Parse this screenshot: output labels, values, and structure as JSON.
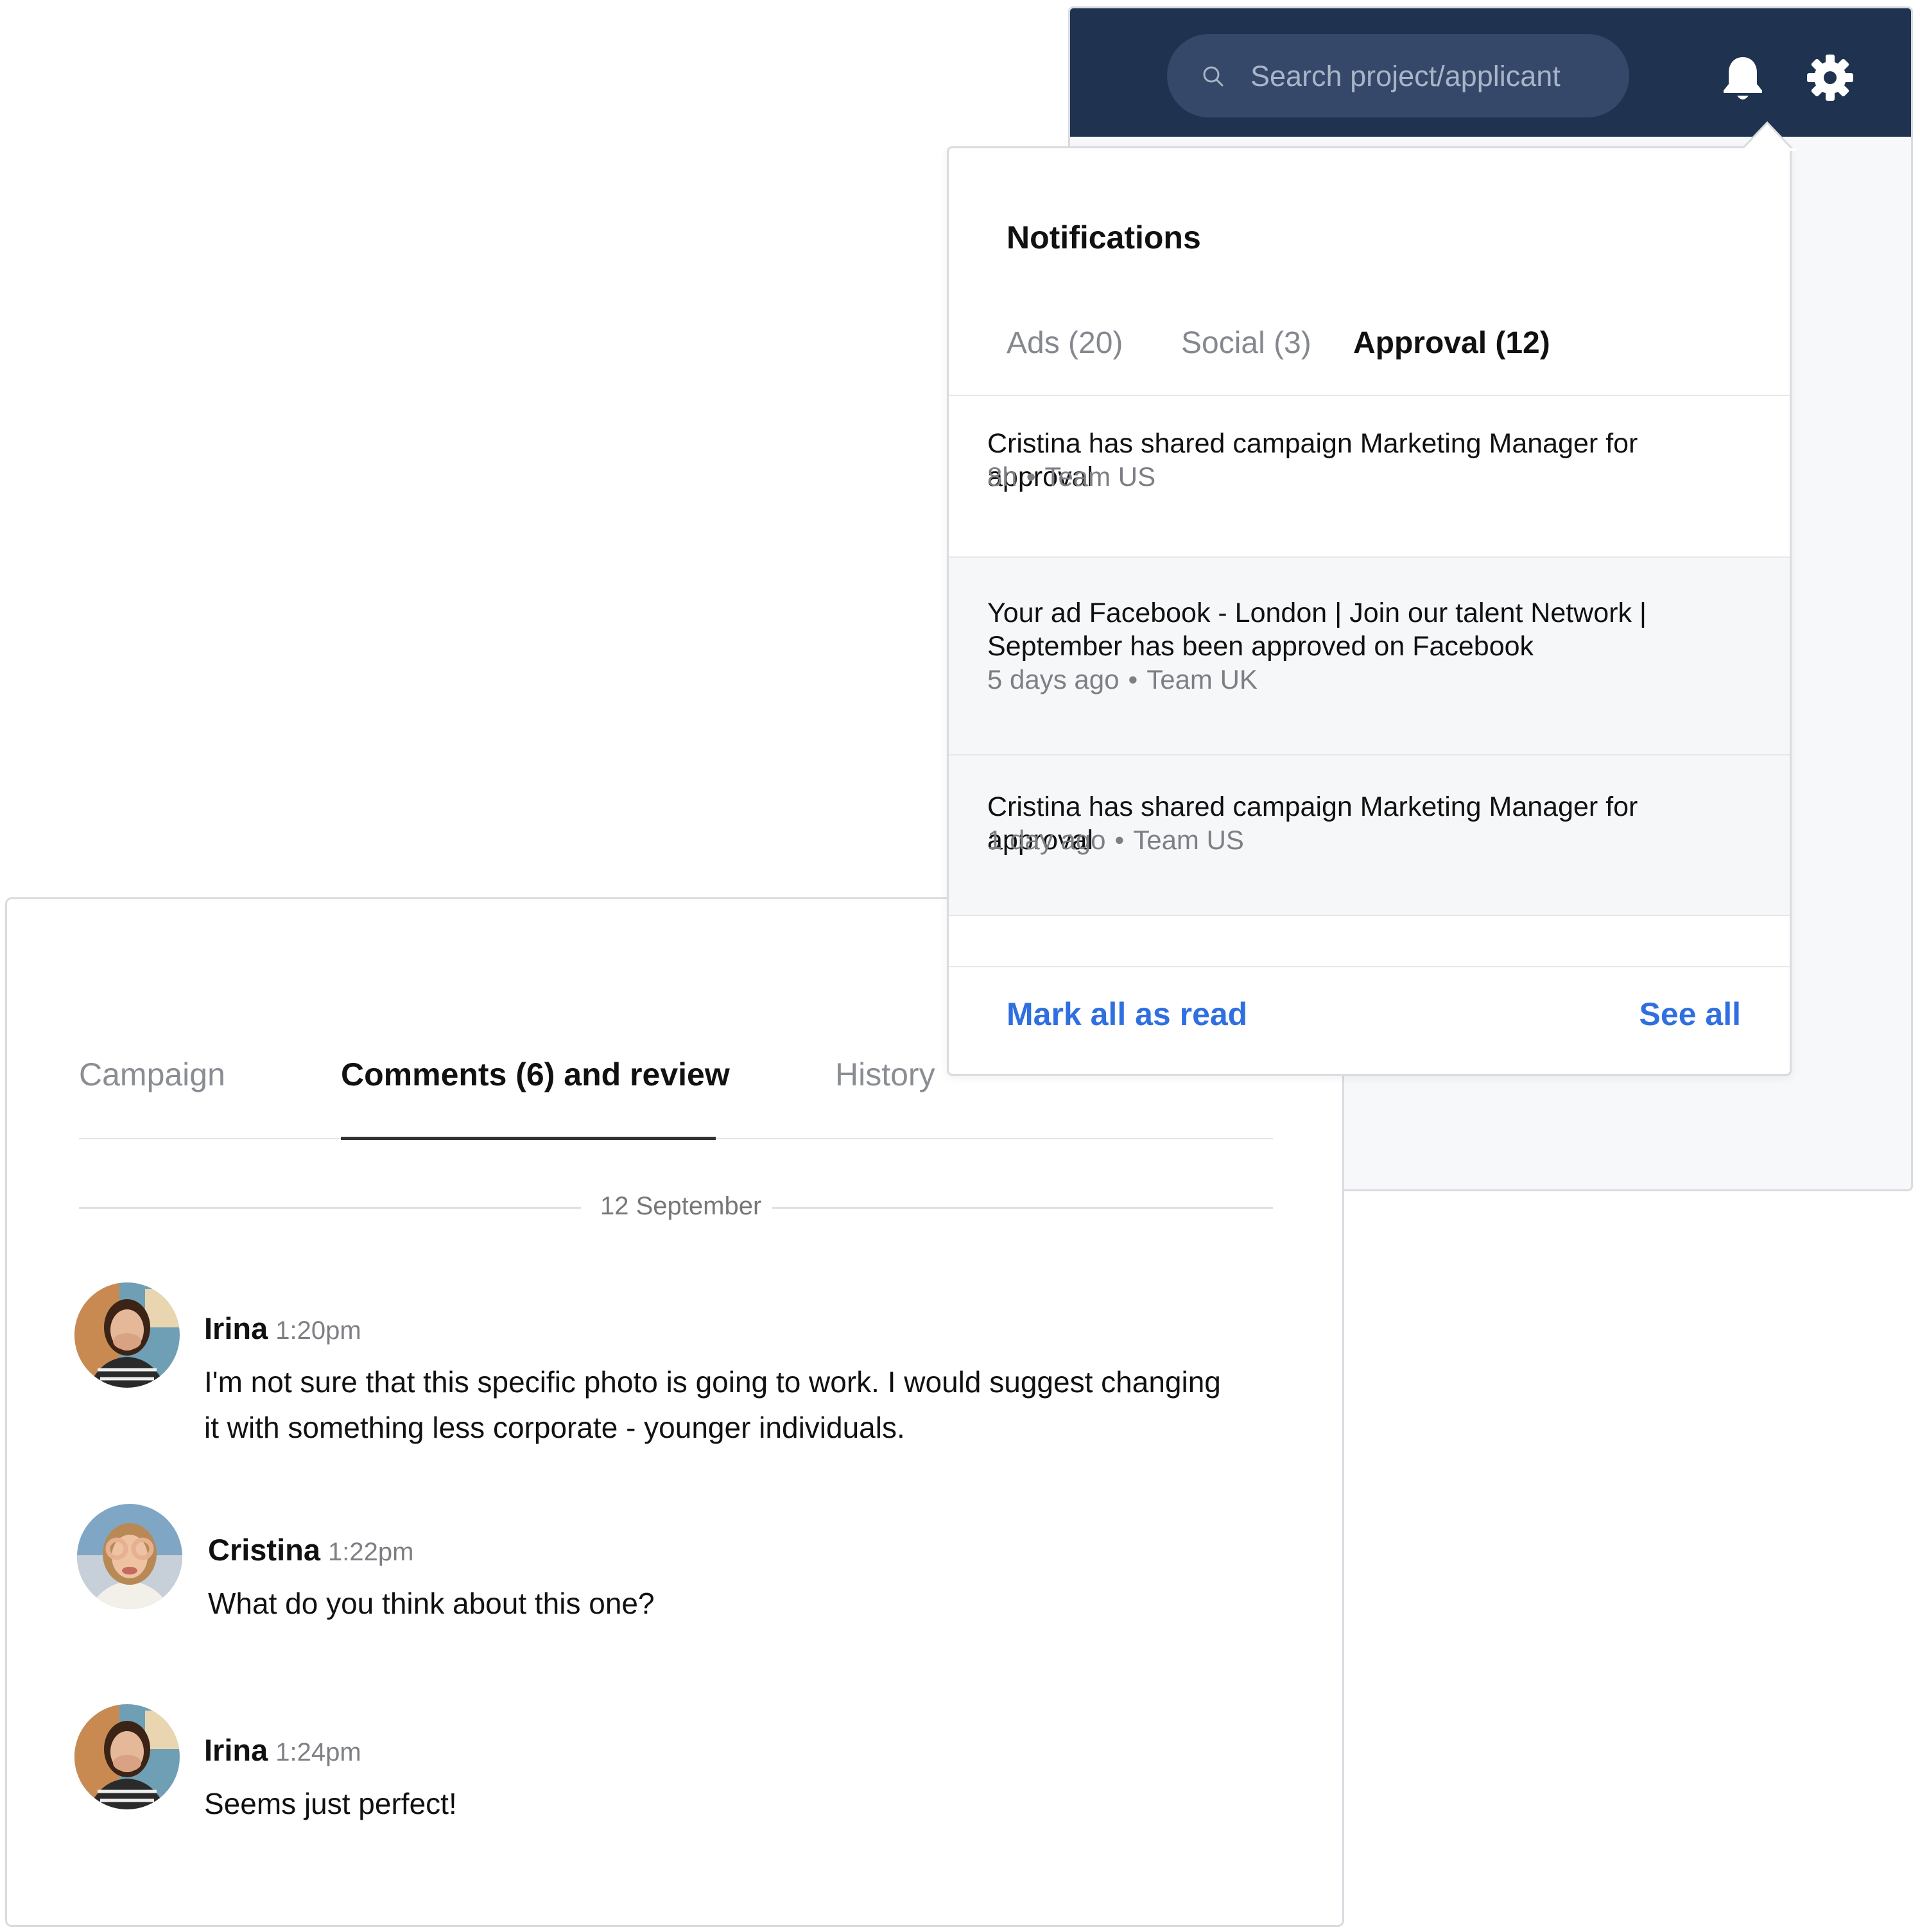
{
  "header": {
    "search": {
      "placeholder": "Search project/applicant",
      "value": ""
    },
    "icons": [
      "search-icon",
      "bell-icon",
      "gear-icon"
    ],
    "colors": {
      "header_bg": "#1f3250",
      "search_bg": "#35486a"
    }
  },
  "notifications": {
    "title": "Notifications",
    "tabs": [
      {
        "label": "Ads (20)",
        "active": false
      },
      {
        "label": "Social (3)",
        "active": false
      },
      {
        "label": "Approval (12)",
        "active": true
      }
    ],
    "items": [
      {
        "text": "Cristina has shared campaign Marketing Manager for approval",
        "time": "8h",
        "team": "Team US",
        "read": true
      },
      {
        "text": "Your ad Facebook - London | Join our talent Network | September has been approved on Facebook",
        "time": "5 days ago",
        "team": "Team UK",
        "read": false
      },
      {
        "text": "Cristina has shared campaign Marketing Manager for approval",
        "time": "1 day ago",
        "team": "Team US",
        "read": false
      }
    ],
    "meta_separator": "•",
    "mark_all_label": "Mark all as read",
    "see_all_label": "See all",
    "colors": {
      "link": "#2f6fe0",
      "unread_bg": "#f6f7f9"
    }
  },
  "comments_panel": {
    "tabs": [
      {
        "label": "Campaign",
        "active": false
      },
      {
        "label": "Comments (6) and review",
        "active": true
      },
      {
        "label": "History",
        "active": false
      }
    ],
    "date_label": "12 September",
    "comments": [
      {
        "author": "Irina",
        "time": "1:20pm",
        "text": "I'm not sure that this specific photo is going to work. I would suggest changing it with something less corporate - younger individuals."
      },
      {
        "author": "Cristina",
        "time": "1:22pm",
        "text": "What do you think about this one?"
      },
      {
        "author": "Irina",
        "time": "1:24pm",
        "text": "Seems just perfect!"
      }
    ]
  }
}
